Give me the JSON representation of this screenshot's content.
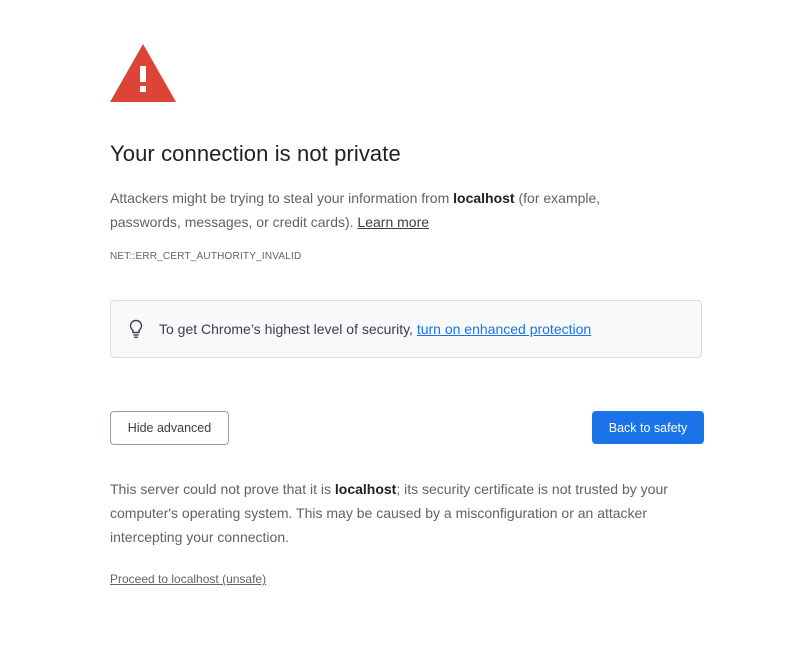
{
  "icons": {
    "warning": "warning-triangle-icon",
    "bulb": "lightbulb-icon"
  },
  "colors": {
    "warning_red": "#db4437",
    "primary_blue": "#1a73e8",
    "link_blue": "#1a73e8"
  },
  "heading": "Your connection is not private",
  "intro": {
    "prefix": "Attackers might be trying to steal your information from ",
    "host": "localhost",
    "suffix": " (for example, passwords, messages, or credit cards). ",
    "learn_more": "Learn more"
  },
  "error_code": "NET::ERR_CERT_AUTHORITY_INVALID",
  "protection": {
    "text": "To get Chrome’s highest level of security, ",
    "link": "turn on enhanced protection"
  },
  "buttons": {
    "hide_advanced": "Hide advanced",
    "back_to_safety": "Back to safety"
  },
  "details": {
    "prefix": "This server could not prove that it is ",
    "host": "localhost",
    "suffix": "; its security certificate is not trusted by your computer's operating system. This may be caused by a misconfiguration or an attacker intercepting your connection."
  },
  "proceed_link": "Proceed to localhost (unsafe)"
}
